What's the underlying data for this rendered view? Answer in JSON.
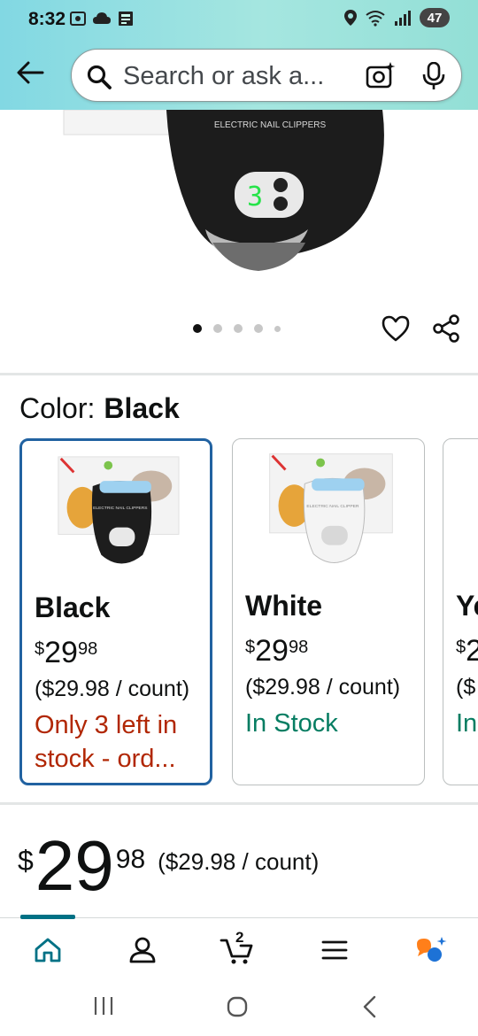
{
  "status_bar": {
    "time": "8:32",
    "battery": "47"
  },
  "search": {
    "placeholder": "Search or ask a..."
  },
  "product_image": {
    "label": "ELECTRIC NAIL CLIPPERS",
    "digit": "3",
    "image_count": 5,
    "active_index": 0
  },
  "color_section": {
    "label": "Color:",
    "selected_value": "Black"
  },
  "swatches": [
    {
      "name": "Black",
      "price_symbol": "$",
      "price_whole": "29",
      "price_fraction": "98",
      "unit_price": "($29.98 / count)",
      "availability": "Only 3 left in stock - ord...",
      "availability_color": "#b12704",
      "selected": true
    },
    {
      "name": "White",
      "price_symbol": "$",
      "price_whole": "29",
      "price_fraction": "98",
      "unit_price": "($29.98 / count)",
      "availability": "In Stock",
      "availability_color": "#067d62",
      "selected": false
    },
    {
      "name": "Ye",
      "price_symbol": "$",
      "price_whole": "2",
      "price_fraction": "",
      "unit_price": "($",
      "availability": "In",
      "availability_color": "#067d62",
      "selected": false
    }
  ],
  "price": {
    "symbol": "$",
    "whole": "29",
    "fraction": "98",
    "unit_price": "($29.98 / count)"
  },
  "bottom_nav": {
    "cart_count": "2",
    "items": [
      "home-icon",
      "account-icon",
      "cart-icon",
      "menu-icon",
      "rufus-icon"
    ]
  },
  "colors": {
    "header_gradient_start": "#82d8e3",
    "selected_border": "#2162a1",
    "low_stock": "#b12704",
    "in_stock": "#067d62",
    "nav_indicator": "#007185"
  }
}
